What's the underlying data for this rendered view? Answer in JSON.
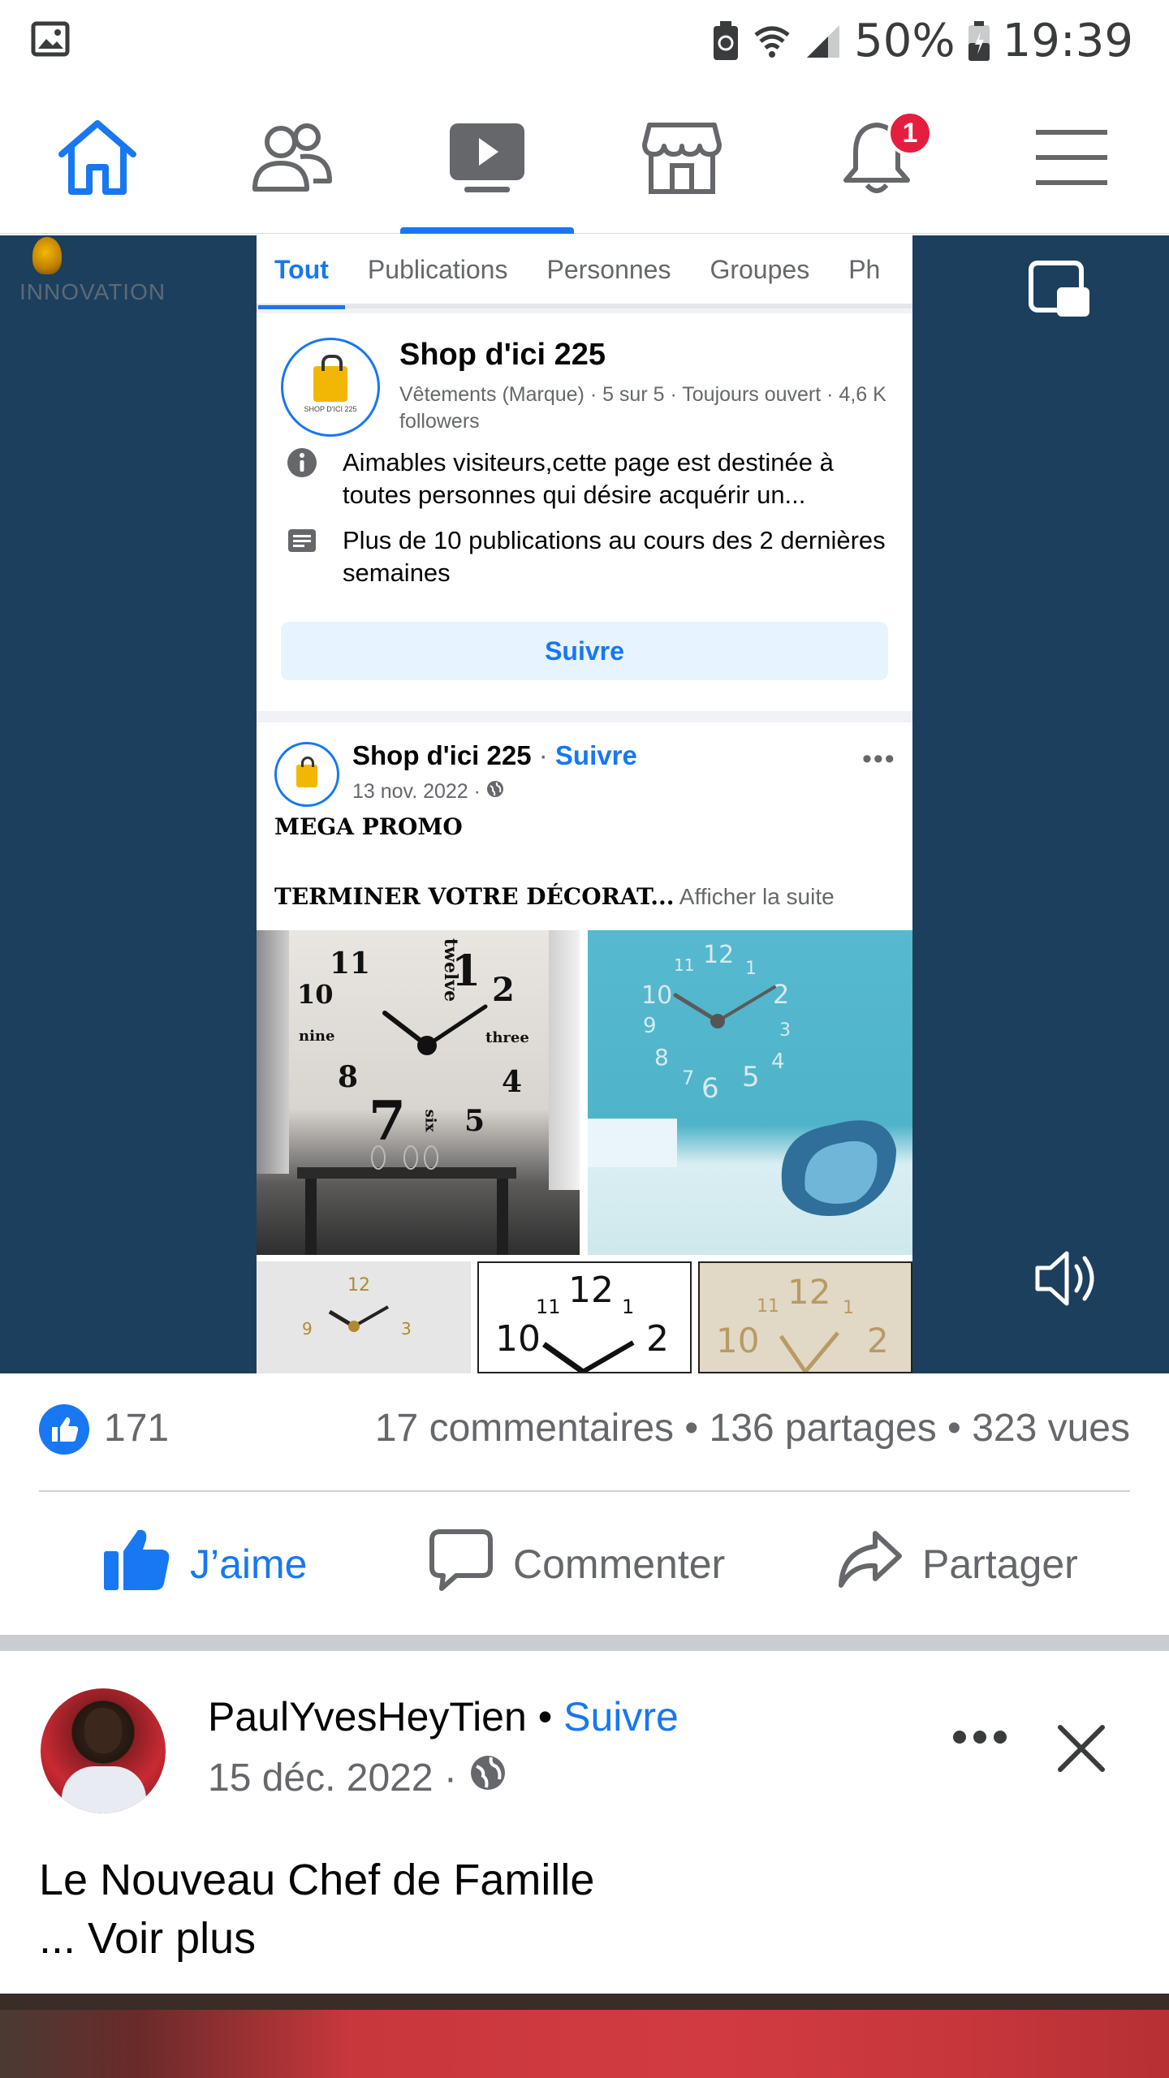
{
  "status_bar": {
    "battery": "50%",
    "time": "19:39"
  },
  "nav": {
    "items": [
      {
        "name": "home-icon"
      },
      {
        "name": "friends-icon"
      },
      {
        "name": "video-icon"
      },
      {
        "name": "marketplace-icon"
      },
      {
        "name": "notifications-icon"
      },
      {
        "name": "menu-icon"
      }
    ],
    "active": "video-icon",
    "notification_badge": "1",
    "accent": "#1877f2"
  },
  "video": {
    "watermark": "INNOVATION",
    "inner": {
      "tabs": [
        "Tout",
        "Publications",
        "Personnes",
        "Groupes",
        "Ph"
      ],
      "page": {
        "name": "Shop d'ici 225",
        "avatar_text": "SHOP D'ICI 225",
        "meta": "Vêtements (Marque) · 5 sur 5 · Toujours ouvert · 4,6 K followers",
        "about": "Aimables visiteurs,cette page est destinée à toutes personnes qui désire acquérir un...",
        "activity": "Plus de 10 publications au cours des 2 dernières semaines",
        "follow_button": "Suivre"
      },
      "post": {
        "author": "Shop d'ici 225",
        "separator": "·",
        "follow": "Suivre",
        "date": "13 nov. 2022 ·",
        "line1": "MEGA PROMO",
        "line2": "TERMINER VOTRE DÉCORAT...",
        "see_more": "Afficher la suite",
        "clock_numbers": [
          "11",
          "twelve",
          "1",
          "2",
          "10",
          "nine",
          "three",
          "8",
          "4",
          "7",
          "six",
          "5"
        ]
      }
    }
  },
  "stats": {
    "likes": "171",
    "summary": "17 commentaires • 136 partages • 323 vues"
  },
  "actions": {
    "like": "J’aime",
    "comment": "Commenter",
    "share": "Partager"
  },
  "next_post": {
    "author": "PaulYvesHeyTien",
    "dot": "•",
    "follow": "Suivre",
    "date": "15 déc. 2022 ·",
    "text_line1": "Le Nouveau Chef de Famille",
    "text_line2": "... Voir plus"
  }
}
